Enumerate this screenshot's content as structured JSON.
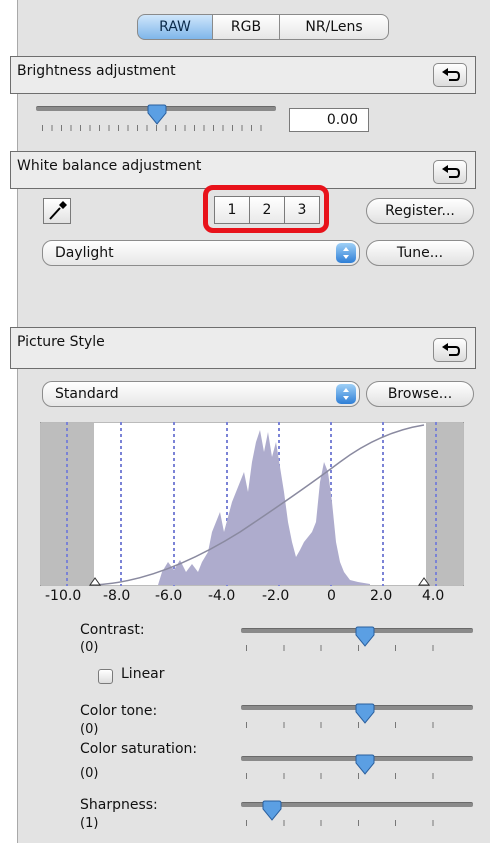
{
  "tabs": [
    {
      "label": "RAW",
      "selected": true
    },
    {
      "label": "RGB",
      "selected": false
    },
    {
      "label": "NR/Lens",
      "selected": false
    }
  ],
  "brightness": {
    "header": "Brightness adjustment",
    "value": "0.00",
    "slider_position": 0.5
  },
  "white_balance": {
    "header": "White balance adjustment",
    "banks": [
      "1",
      "2",
      "3"
    ],
    "register_label": "Register...",
    "preset": "Daylight",
    "tune_label": "Tune..."
  },
  "picture_style": {
    "header": "Picture Style",
    "style": "Standard",
    "browse_label": "Browse...",
    "histogram_axis": [
      "-10.0",
      "-8.0",
      "-6.0",
      "-4.0",
      "-2.0",
      "0",
      "2.0",
      "4.0"
    ],
    "params": [
      {
        "label": "Contrast:",
        "value": "(0)",
        "position": 0.5
      },
      {
        "label": "Color tone:",
        "value": "(0)",
        "position": 0.5
      },
      {
        "label": "Color saturation:",
        "value": "(0)",
        "position": 0.5
      },
      {
        "label": "Sharpness:",
        "value": "(1)",
        "position": 0.143
      }
    ],
    "linear_label": "Linear",
    "linear_checked": false
  },
  "colors": {
    "highlight": "#e8121a",
    "accent": "#3f86d9",
    "histogram": "#aeaccd"
  },
  "icons": [
    "reset-icon",
    "eyedropper-icon",
    "popup-arrows-icon",
    "slider-knob-icon"
  ]
}
